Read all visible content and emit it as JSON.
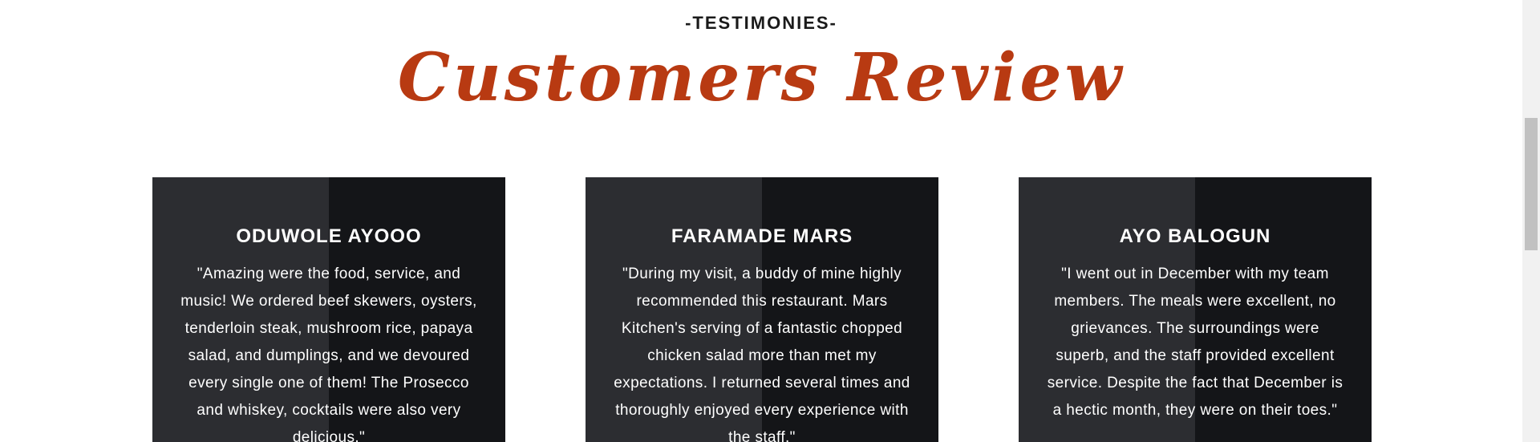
{
  "section": {
    "eyebrow": "-TESTIMONIES-",
    "title": "Customers Review"
  },
  "reviews": [
    {
      "name": "ODUWOLE AYOOO",
      "quote": "\"Amazing were the food, service, and music! We ordered beef skewers, oysters, tenderloin steak, mushroom rice, papaya salad, and dumplings, and we devoured every single one of them! The Prosecco and whiskey, cocktails were also very delicious.\""
    },
    {
      "name": "FARAMADE MARS",
      "quote": "\"During my visit, a buddy of mine highly recommended this restaurant. Mars Kitchen's serving of a fantastic chopped chicken salad more than met my expectations. I returned several times and thoroughly enjoyed every experience with the staff.\""
    },
    {
      "name": "AYO BALOGUN",
      "quote": "\"I went out in December with my team members. The meals were excellent, no grievances. The surroundings were superb, and the staff provided excellent service. Despite the fact that December is a hectic month, they were on their toes.\""
    }
  ],
  "colors": {
    "accent": "#b83a12",
    "card_left": "#2c2d31",
    "card_right": "#141518"
  }
}
